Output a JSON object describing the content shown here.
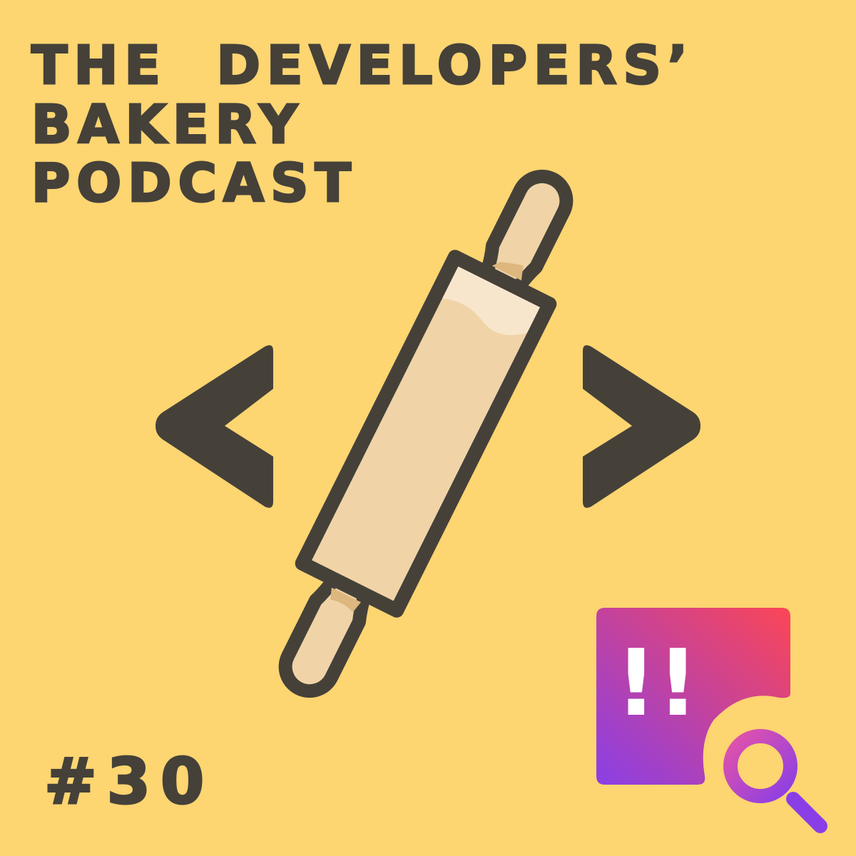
{
  "title": {
    "line1": "THE  DEVELOPERS’",
    "line2": "BAKERY",
    "line3": "PODCAST"
  },
  "episode": "#30",
  "badge": {
    "text": "!!",
    "gradient_start": "#8A3FE6",
    "gradient_end": "#FB4656"
  },
  "colors": {
    "background": "#FDD571",
    "ink": "#454139",
    "wood_light": "#F0D4A8",
    "wood_highlight": "#F8E6CC",
    "wood_shadow": "#DDB77D"
  },
  "icons": [
    "code-bracket-left-icon",
    "rolling-pin-icon",
    "code-bracket-right-icon",
    "search-icon"
  ]
}
